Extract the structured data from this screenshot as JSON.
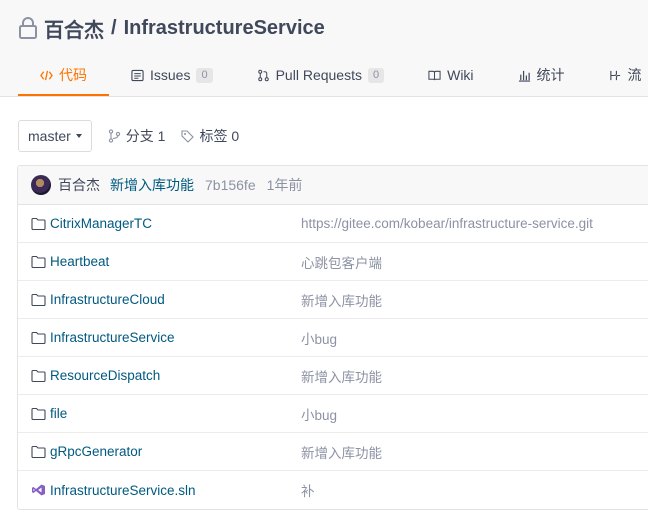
{
  "repo": {
    "owner": "百合杰",
    "separator": "/",
    "name": "InfrastructureService"
  },
  "tabs": [
    {
      "label": "代码",
      "active": true
    },
    {
      "label": "Issues",
      "count": "0"
    },
    {
      "label": "Pull Requests",
      "count": "0"
    },
    {
      "label": "Wiki"
    },
    {
      "label": "统计"
    },
    {
      "label": "流"
    }
  ],
  "branch_bar": {
    "branch": "master",
    "branches_label": "分支 1",
    "tags_label": "标签 0"
  },
  "latest_commit": {
    "author": "百合杰",
    "message": "新增入库功能",
    "sha": "7b156fe",
    "time": "1年前"
  },
  "files": [
    {
      "name": "CitrixManagerTC",
      "type": "folder",
      "message": "https://gitee.com/kobear/infrastructure-service.git"
    },
    {
      "name": "Heartbeat",
      "type": "folder",
      "message": "心跳包客户端"
    },
    {
      "name": "InfrastructureCloud",
      "type": "folder",
      "message": "新增入库功能"
    },
    {
      "name": "InfrastructureService",
      "type": "folder",
      "message": "小bug"
    },
    {
      "name": "ResourceDispatch",
      "type": "folder",
      "message": "新增入库功能"
    },
    {
      "name": "file",
      "type": "folder",
      "message": "小bug"
    },
    {
      "name": "gRpcGenerator",
      "type": "folder",
      "message": "新增入库功能"
    },
    {
      "name": "InfrastructureService.sln",
      "type": "visual-studio-solution",
      "message": "补"
    }
  ],
  "colors": {
    "accent": "#fe7300",
    "link": "#005980",
    "text": "#40485b",
    "muted": "#8c92a4",
    "vs_purple": "#865fc5"
  }
}
